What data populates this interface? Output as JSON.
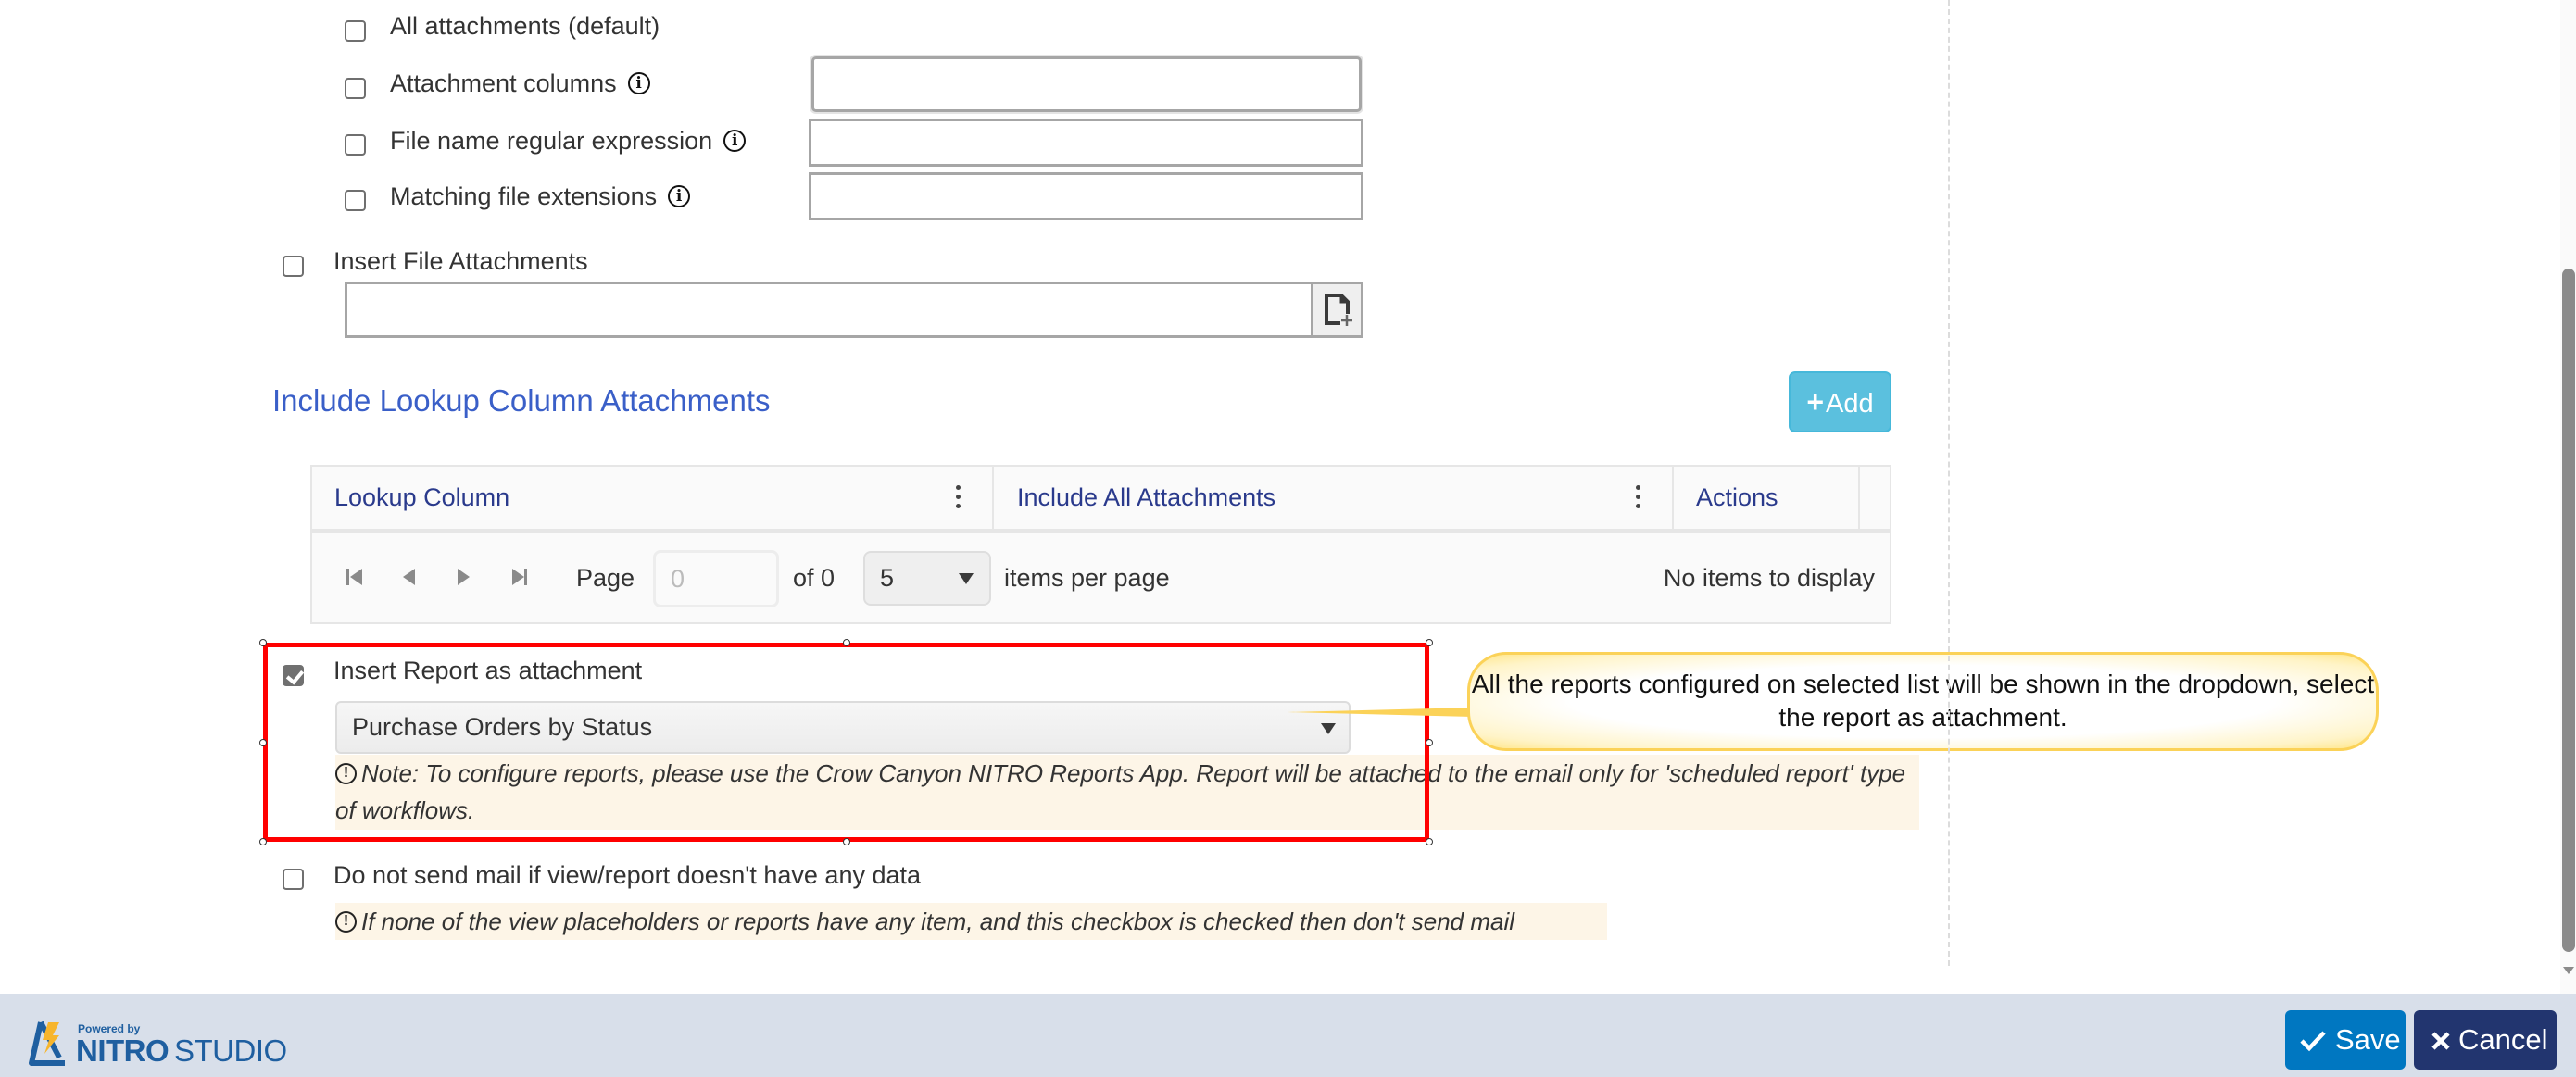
{
  "attachment_options": {
    "all_attachments": {
      "label": "All attachments (default)",
      "checked": false
    },
    "attachment_columns": {
      "label": "Attachment columns",
      "checked": false,
      "value": "",
      "info_icon": "info-icon"
    },
    "file_name_regex": {
      "label": "File name regular expression",
      "checked": false,
      "value": "",
      "info_icon": "info-icon"
    },
    "matching_file_extensions": {
      "label": "Matching file extensions",
      "checked": false,
      "value": "",
      "info_icon": "info-icon"
    }
  },
  "insert_file_attachments": {
    "label": "Insert File Attachments",
    "checked": false,
    "value": "",
    "attach_icon": "file-add-icon"
  },
  "lookup_section": {
    "title": "Include Lookup Column Attachments",
    "add_button": {
      "icon": "+",
      "label": "Add"
    },
    "grid": {
      "columns": [
        "Lookup Column",
        "Include All Attachments",
        "Actions"
      ],
      "rows": [],
      "pager": {
        "page_label": "Page",
        "page_value": "0",
        "of_label": "of 0",
        "page_size": "5",
        "items_per_page_label": "items per page",
        "status": "No items to display"
      }
    }
  },
  "insert_report": {
    "label": "Insert Report as attachment",
    "checked": true,
    "selected_report": "Purchase Orders by Status",
    "note_icon": "!",
    "note": "Note: To configure reports, please use the Crow Canyon NITRO Reports App. Report will be attached to the email only for 'scheduled report' type of workflows."
  },
  "callout": {
    "text": "All the reports configured on selected list will be shown in the dropdown, select the report as attachment.",
    "color": "#fbd258"
  },
  "highlight": {
    "color": "#ff0000"
  },
  "no_data": {
    "label": "Do not send mail if view/report doesn't have any data",
    "checked": false,
    "note_icon": "!",
    "note": "If none of the view placeholders or reports have any item, and this checkbox is checked then don't send mail"
  },
  "footer": {
    "logo_powered_by": "Powered by",
    "logo_nitro": "NITRO",
    "logo_studio": "STUDIO",
    "save_label": "Save",
    "cancel_label": "Cancel",
    "save_color": "#0077c1",
    "cancel_color": "#22356f"
  }
}
